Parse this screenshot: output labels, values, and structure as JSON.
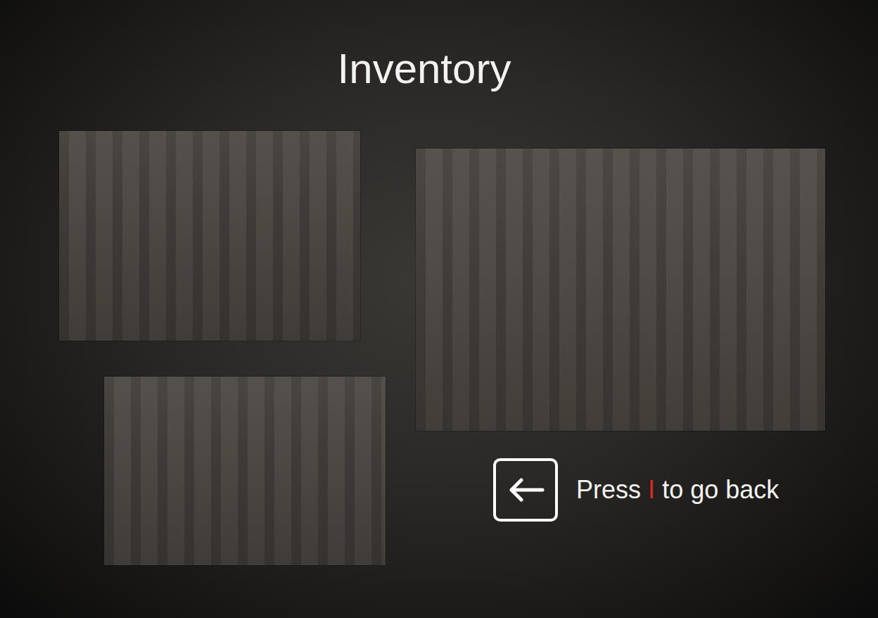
{
  "screen": {
    "title": "Inventory"
  },
  "items": [
    {
      "kind": "photo"
    },
    {
      "kind": "photo"
    },
    {
      "kind": "photo"
    }
  ],
  "hint": {
    "before": "Press",
    "key": "I",
    "after": "to go back"
  }
}
